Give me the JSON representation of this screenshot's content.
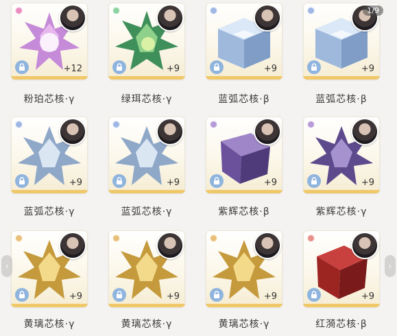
{
  "pager": "1/9",
  "colors": {
    "card_bottom": "#f0c86a",
    "lock": "#8fb4de"
  },
  "items": [
    {
      "name": "粉珀芯核·γ",
      "count": "+12",
      "dot_color": "#e98fc0",
      "gem": "star-pink-icon"
    },
    {
      "name": "绿珥芯核·γ",
      "count": "+9",
      "dot_color": "#8fd2a2",
      "gem": "star-green-icon"
    },
    {
      "name": "蓝弧芯核·β",
      "count": "+9",
      "dot_color": "#9fb7e4",
      "gem": "cube-ice-icon"
    },
    {
      "name": "蓝弧芯核·β",
      "count": "+9",
      "dot_color": "#9fb7e4",
      "gem": "cube-ice-icon"
    },
    {
      "name": "蓝弧芯核·γ",
      "count": "+9",
      "dot_color": "#9fb7e4",
      "gem": "star-ice-icon"
    },
    {
      "name": "蓝弧芯核·γ",
      "count": "+9",
      "dot_color": "#9fb7e4",
      "gem": "star-ice-icon"
    },
    {
      "name": "紫辉芯核·β",
      "count": "+9",
      "dot_color": "#b79ad8",
      "gem": "cube-purple-icon"
    },
    {
      "name": "紫辉芯核·γ",
      "count": "+9",
      "dot_color": "#b79ad8",
      "gem": "star-purple-icon"
    },
    {
      "name": "黄璃芯核·γ",
      "count": "+9",
      "dot_color": "#e9c07a",
      "gem": "star-gold-icon"
    },
    {
      "name": "黄璃芯核·γ",
      "count": "+9",
      "dot_color": "#e9c07a",
      "gem": "star-gold-icon"
    },
    {
      "name": "黄璃芯核·γ",
      "count": "+9",
      "dot_color": "#e9c07a",
      "gem": "star-gold-icon"
    },
    {
      "name": "红漪芯核·β",
      "count": "+9",
      "dot_color": "#e8908a",
      "gem": "cube-red-icon"
    }
  ]
}
